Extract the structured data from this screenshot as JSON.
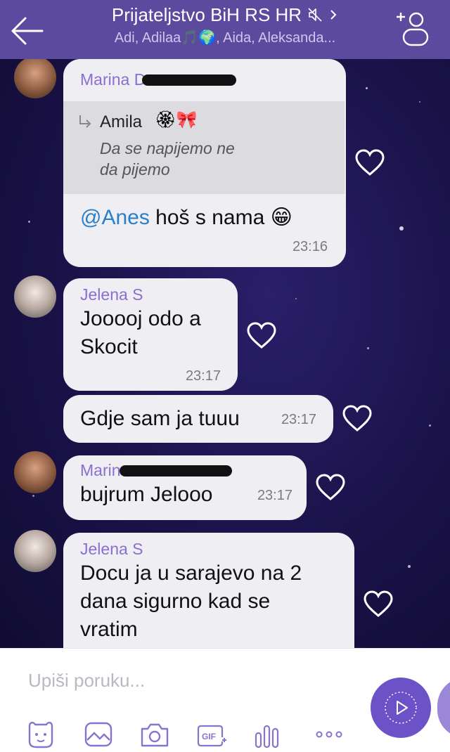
{
  "header": {
    "title": "Prijateljstvo BiH RS HR",
    "subtitle": "Adi, Adilaa🎵🌍, Aida, Aleksanda..."
  },
  "messages": [
    {
      "sender": "Marina D",
      "quote_author": "Amila",
      "quote_text_line1": "Da se napijemo ne",
      "quote_text_line2": "da pijemo",
      "mention": "@Anes",
      "text": " hoš s nama 😁",
      "time": "23:16"
    },
    {
      "sender": "Jelena S",
      "text_line1": "Jooooj odo a",
      "text_line2": "Skocit",
      "time": "23:17"
    },
    {
      "text": "Gdje sam ja tuuu",
      "time": "23:17"
    },
    {
      "sender": "Marina",
      "text": "bujrum Jelooo",
      "time": "23:17"
    },
    {
      "sender": "Jelena S",
      "text_line1": "Docu ja u sarajevo na 2",
      "text_line2": "dana sigurno kad se",
      "text_line3": "vratim"
    }
  ],
  "composer": {
    "placeholder": "Upiši poruku..."
  },
  "icons": {
    "back": "arrow-left-icon",
    "mute": "speaker-muted-icon",
    "add_user": "add-participant-icon",
    "heart": "heart-outline-icon",
    "sticker": "sticker-icon",
    "gallery": "image-icon",
    "camera": "camera-icon",
    "gif": "gif-icon",
    "poll": "bars-icon",
    "more": "more-dots-icon",
    "send": "play-icon"
  },
  "colors": {
    "header": "#5b4a9e",
    "accent": "#6b52c7",
    "sender": "#8a6fd1",
    "mention": "#2a7fc8"
  }
}
